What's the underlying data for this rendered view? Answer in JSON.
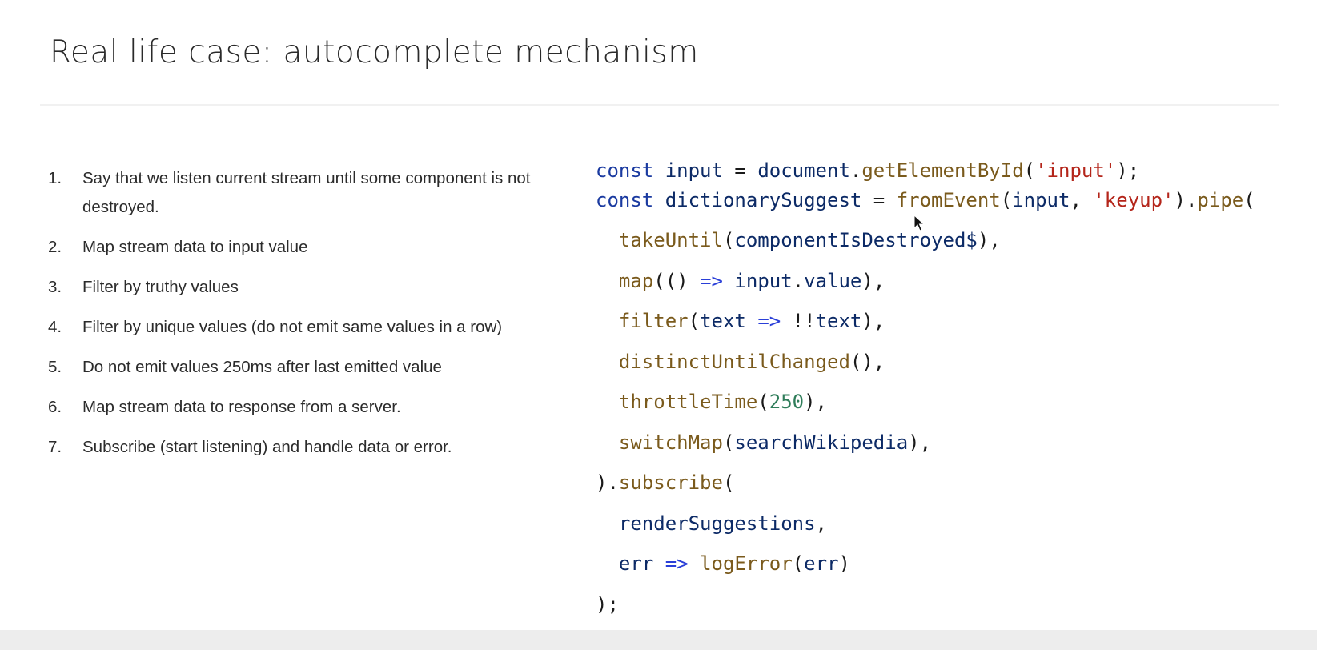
{
  "slide": {
    "title": "Real life case: autocomplete mechanism",
    "steps": [
      {
        "number": "1.",
        "text": "Say that we listen current stream until some component is not destroyed."
      },
      {
        "number": "2.",
        "text": "Map stream data to input value"
      },
      {
        "number": "3.",
        "text": "Filter by truthy values"
      },
      {
        "number": "4.",
        "text": "Filter by unique values (do not emit same values in a row)"
      },
      {
        "number": "5.",
        "text": "Do not emit values 250ms after last emitted value"
      },
      {
        "number": "6.",
        "text": "Map stream data to response from a server."
      },
      {
        "number": "7.",
        "text": "Subscribe (start listening) and handle data or error."
      }
    ]
  },
  "code": {
    "lines": [
      [
        {
          "t": "const",
          "c": "kw"
        },
        {
          "t": " ",
          "c": "op"
        },
        {
          "t": "input",
          "c": "var"
        },
        {
          "t": " = ",
          "c": "op"
        },
        {
          "t": "document",
          "c": "var"
        },
        {
          "t": ".",
          "c": "op"
        },
        {
          "t": "getElementById",
          "c": "fn"
        },
        {
          "t": "(",
          "c": "op"
        },
        {
          "t": "'input'",
          "c": "str"
        },
        {
          "t": ");",
          "c": "op"
        }
      ],
      [
        {
          "t": "const",
          "c": "kw"
        },
        {
          "t": " ",
          "c": "op"
        },
        {
          "t": "dictionarySuggest",
          "c": "var"
        },
        {
          "t": " = ",
          "c": "op"
        },
        {
          "t": "fromEvent",
          "c": "fn"
        },
        {
          "t": "(",
          "c": "op"
        },
        {
          "t": "input",
          "c": "var"
        },
        {
          "t": ", ",
          "c": "op"
        },
        {
          "t": "'keyup'",
          "c": "str"
        },
        {
          "t": ").",
          "c": "op"
        },
        {
          "t": "pipe",
          "c": "fn"
        },
        {
          "t": "(",
          "c": "op"
        }
      ],
      [
        {
          "t": "  ",
          "c": "op"
        },
        {
          "t": "takeUntil",
          "c": "fn"
        },
        {
          "t": "(",
          "c": "op"
        },
        {
          "t": "componentIsDestroyed$",
          "c": "var"
        },
        {
          "t": "),",
          "c": "op"
        }
      ],
      [
        {
          "t": "  ",
          "c": "op"
        },
        {
          "t": "map",
          "c": "fn"
        },
        {
          "t": "(() ",
          "c": "op"
        },
        {
          "t": "=>",
          "c": "arrow"
        },
        {
          "t": " ",
          "c": "op"
        },
        {
          "t": "input",
          "c": "var"
        },
        {
          "t": ".",
          "c": "op"
        },
        {
          "t": "value",
          "c": "var"
        },
        {
          "t": "),",
          "c": "op"
        }
      ],
      [
        {
          "t": "  ",
          "c": "op"
        },
        {
          "t": "filter",
          "c": "fn"
        },
        {
          "t": "(",
          "c": "op"
        },
        {
          "t": "text",
          "c": "var"
        },
        {
          "t": " ",
          "c": "op"
        },
        {
          "t": "=>",
          "c": "arrow"
        },
        {
          "t": " !!",
          "c": "op"
        },
        {
          "t": "text",
          "c": "var"
        },
        {
          "t": "),",
          "c": "op"
        }
      ],
      [
        {
          "t": "  ",
          "c": "op"
        },
        {
          "t": "distinctUntilChanged",
          "c": "fn"
        },
        {
          "t": "(),",
          "c": "op"
        }
      ],
      [
        {
          "t": "  ",
          "c": "op"
        },
        {
          "t": "throttleTime",
          "c": "fn"
        },
        {
          "t": "(",
          "c": "op"
        },
        {
          "t": "250",
          "c": "num"
        },
        {
          "t": "),",
          "c": "op"
        }
      ],
      [
        {
          "t": "  ",
          "c": "op"
        },
        {
          "t": "switchMap",
          "c": "fn"
        },
        {
          "t": "(",
          "c": "op"
        },
        {
          "t": "searchWikipedia",
          "c": "var"
        },
        {
          "t": "),",
          "c": "op"
        }
      ],
      [
        {
          "t": ").",
          "c": "op"
        },
        {
          "t": "subscribe",
          "c": "fn"
        },
        {
          "t": "(",
          "c": "op"
        }
      ],
      [
        {
          "t": "  ",
          "c": "op"
        },
        {
          "t": "renderSuggestions",
          "c": "var"
        },
        {
          "t": ",",
          "c": "op"
        }
      ],
      [
        {
          "t": "  ",
          "c": "op"
        },
        {
          "t": "err",
          "c": "var"
        },
        {
          "t": " ",
          "c": "op"
        },
        {
          "t": "=>",
          "c": "arrow"
        },
        {
          "t": " ",
          "c": "op"
        },
        {
          "t": "logError",
          "c": "fn"
        },
        {
          "t": "(",
          "c": "op"
        },
        {
          "t": "err",
          "c": "var"
        },
        {
          "t": ")",
          "c": "op"
        }
      ],
      [
        {
          "t": ");",
          "c": "op"
        }
      ]
    ]
  },
  "cursor": {
    "icon": "mouse-pointer-icon"
  },
  "colors": {
    "keyword": "#1a3aa0",
    "identifier": "#0c2a66",
    "function": "#7a5a1c",
    "string": "#b4251a",
    "number": "#2f7d5a",
    "arrow": "#2a3fd8"
  }
}
